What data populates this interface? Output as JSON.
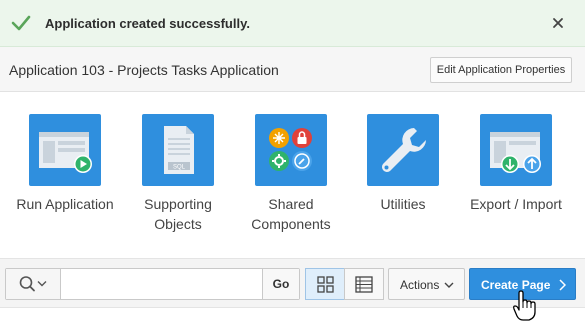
{
  "alert": {
    "message": "Application created successfully.",
    "icon": "check-icon",
    "close_icon": "close-icon",
    "color": "#5aa55a"
  },
  "header": {
    "title": "Application 103 - Projects Tasks Application",
    "edit_button": "Edit Application Properties"
  },
  "tiles": [
    {
      "label": "Run Application",
      "icon": "run-application-icon"
    },
    {
      "label": "Supporting Objects",
      "icon": "sql-document-icon"
    },
    {
      "label": "Shared Components",
      "icon": "shared-components-icon"
    },
    {
      "label": "Utilities",
      "icon": "wrench-icon"
    },
    {
      "label": "Export / Import",
      "icon": "export-import-icon"
    }
  ],
  "toolbar": {
    "search_placeholder": "",
    "search_value": "",
    "go_label": "Go",
    "actions_label": "Actions",
    "create_label": "Create Page",
    "active_view": "icons"
  },
  "colors": {
    "accent": "#2f8fde",
    "success": "#5aa55a",
    "green_badge": "#2fb36b"
  }
}
